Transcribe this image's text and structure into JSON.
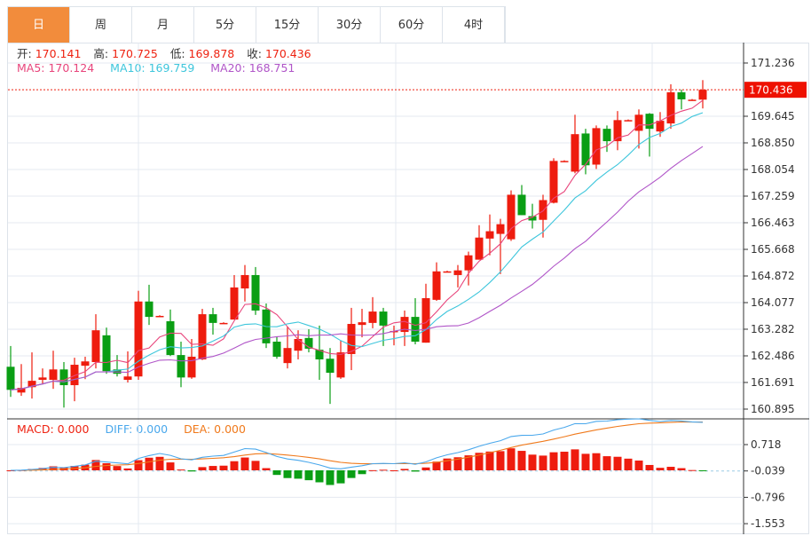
{
  "tabs": [
    {
      "label": "日",
      "active": true
    },
    {
      "label": "周"
    },
    {
      "label": "月"
    },
    {
      "label": "5分"
    },
    {
      "label": "15分"
    },
    {
      "label": "30分"
    },
    {
      "label": "60分"
    },
    {
      "label": "4时"
    }
  ],
  "ohlc_legend": {
    "open_label": "开:",
    "open": "170.141",
    "high_label": "高:",
    "high": "170.725",
    "low_label": "低:",
    "low": "169.878",
    "close_label": "收:",
    "close": "170.436"
  },
  "ma_legend": {
    "ma5": "MA5: 170.124",
    "ma10": "MA10: 169.759",
    "ma20": "MA20: 168.751"
  },
  "macd_legend": {
    "macd": "MACD: 0.000",
    "diff": "DIFF: 0.000",
    "dea": "DEA: 0.000"
  },
  "current_price_tag": "170.436",
  "colors": {
    "up": "#ee1c0e",
    "down": "#0a9e14",
    "ma5": "#e8457c",
    "ma10": "#3ec6dc",
    "ma20": "#b055c8",
    "diff": "#4aa8ec",
    "dea": "#f07a1c",
    "accent": "#f28c3c"
  },
  "chart_data": [
    {
      "type": "candlestick",
      "title": "",
      "up_color_meaning": "red = close above open",
      "y_ticks": [
        "171.236",
        "170.436",
        "169.645",
        "168.850",
        "168.054",
        "167.259",
        "166.463",
        "165.668",
        "164.872",
        "164.077",
        "163.282",
        "162.486",
        "161.691",
        "160.895"
      ],
      "ylim": [
        160.895,
        171.236
      ],
      "ohlc": [
        [
          162.16,
          162.78,
          161.26,
          161.47
        ],
        [
          161.39,
          162.24,
          161.29,
          161.53
        ],
        [
          161.55,
          162.59,
          161.21,
          161.74
        ],
        [
          161.77,
          162.11,
          161.63,
          161.84
        ],
        [
          161.77,
          162.64,
          161.5,
          162.08
        ],
        [
          162.08,
          162.3,
          160.94,
          161.61
        ],
        [
          161.61,
          162.43,
          161.13,
          162.22
        ],
        [
          162.19,
          162.46,
          161.79,
          162.32
        ],
        [
          162.3,
          163.73,
          162.11,
          163.25
        ],
        [
          163.1,
          163.33,
          161.95,
          162.03
        ],
        [
          162.08,
          162.51,
          161.87,
          161.95
        ],
        [
          161.77,
          162.62,
          161.69,
          161.87
        ],
        [
          161.87,
          164.43,
          161.77,
          164.11
        ],
        [
          164.11,
          164.61,
          163.41,
          163.65
        ],
        [
          163.68,
          163.7,
          163.66,
          163.68
        ],
        [
          163.52,
          163.87,
          162.48,
          162.51
        ],
        [
          162.51,
          162.91,
          161.55,
          161.84
        ],
        [
          161.84,
          162.99,
          161.8,
          162.46
        ],
        [
          162.38,
          163.89,
          162.36,
          163.73
        ],
        [
          163.73,
          163.92,
          163.12,
          163.47
        ],
        [
          163.47,
          163.49,
          163.45,
          163.47
        ],
        [
          163.57,
          164.9,
          163.57,
          164.53
        ],
        [
          164.5,
          165.2,
          164.11,
          164.9
        ],
        [
          164.9,
          165.14,
          163.71,
          163.84
        ],
        [
          163.87,
          164.05,
          162.72,
          162.86
        ],
        [
          162.91,
          163.07,
          162.4,
          162.46
        ],
        [
          162.27,
          163.36,
          162.11,
          162.72
        ],
        [
          162.64,
          163.25,
          162.38,
          162.99
        ],
        [
          163.02,
          163.28,
          162.59,
          162.7
        ],
        [
          162.67,
          163.39,
          161.77,
          162.38
        ],
        [
          162.4,
          162.72,
          161.05,
          161.98
        ],
        [
          161.84,
          162.94,
          161.8,
          162.59
        ],
        [
          162.54,
          163.92,
          162.06,
          163.44
        ],
        [
          163.41,
          163.89,
          163.04,
          163.49
        ],
        [
          163.47,
          164.24,
          163.31,
          163.81
        ],
        [
          163.81,
          163.92,
          162.78,
          163.39
        ],
        [
          163.23,
          163.39,
          162.8,
          163.23
        ],
        [
          163.2,
          163.84,
          162.78,
          163.65
        ],
        [
          163.65,
          164.21,
          162.83,
          162.91
        ],
        [
          162.88,
          164.64,
          162.88,
          164.21
        ],
        [
          164.16,
          165.28,
          164.13,
          165.01
        ],
        [
          165.01,
          165.03,
          164.99,
          165.01
        ],
        [
          164.9,
          165.2,
          164.53,
          165.04
        ],
        [
          165.04,
          165.6,
          164.59,
          165.49
        ],
        [
          165.36,
          166.39,
          165.36,
          166.02
        ],
        [
          165.99,
          166.71,
          165.49,
          166.21
        ],
        [
          166.13,
          166.58,
          164.93,
          166.42
        ],
        [
          165.97,
          167.43,
          165.92,
          167.3
        ],
        [
          167.3,
          167.59,
          166.69,
          166.69
        ],
        [
          166.66,
          167.03,
          166.29,
          166.53
        ],
        [
          166.55,
          167.3,
          166.02,
          167.14
        ],
        [
          167.06,
          168.39,
          167.04,
          168.31
        ],
        [
          168.31,
          168.33,
          168.29,
          168.31
        ],
        [
          167.99,
          169.69,
          167.94,
          169.11
        ],
        [
          169.13,
          169.27,
          167.91,
          168.18
        ],
        [
          168.2,
          169.37,
          168.07,
          169.29
        ],
        [
          169.27,
          169.37,
          168.58,
          168.9
        ],
        [
          168.9,
          169.8,
          168.63,
          169.53
        ],
        [
          169.53,
          169.55,
          169.51,
          169.53
        ],
        [
          169.21,
          169.85,
          168.68,
          169.69
        ],
        [
          169.72,
          169.74,
          168.44,
          169.27
        ],
        [
          169.19,
          169.77,
          169.03,
          169.51
        ],
        [
          169.43,
          170.6,
          169.27,
          170.36
        ],
        [
          170.36,
          170.44,
          169.85,
          170.15
        ],
        [
          170.14,
          170.16,
          170.12,
          170.14
        ],
        [
          170.141,
          170.725,
          169.878,
          170.436
        ]
      ],
      "series": [
        "MA5",
        "MA10",
        "MA20"
      ]
    },
    {
      "type": "bar+line",
      "title": "MACD",
      "y_ticks": [
        "0.718",
        "-0.039",
        "-0.796",
        "-1.553"
      ],
      "series": [
        "MACD",
        "DIFF",
        "DEA"
      ]
    }
  ]
}
